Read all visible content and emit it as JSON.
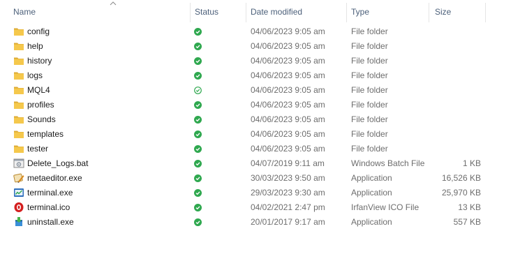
{
  "columns": {
    "name": "Name",
    "status": "Status",
    "date_modified": "Date modified",
    "type": "Type",
    "size": "Size"
  },
  "colors": {
    "folder": "#f5c84c",
    "status_green": "#2fa84f",
    "header_text": "#4c607a",
    "secondary_text": "#6d6d6d"
  },
  "files": [
    {
      "name": "config",
      "icon": "folder-icon",
      "status": "synced-filled",
      "date": "04/06/2023 9:05 am",
      "type": "File folder",
      "size": ""
    },
    {
      "name": "help",
      "icon": "folder-icon",
      "status": "synced-filled",
      "date": "04/06/2023 9:05 am",
      "type": "File folder",
      "size": ""
    },
    {
      "name": "history",
      "icon": "folder-icon",
      "status": "synced-filled",
      "date": "04/06/2023 9:05 am",
      "type": "File folder",
      "size": ""
    },
    {
      "name": "logs",
      "icon": "folder-icon",
      "status": "synced-filled",
      "date": "04/06/2023 9:05 am",
      "type": "File folder",
      "size": ""
    },
    {
      "name": "MQL4",
      "icon": "folder-icon",
      "status": "synced-outline",
      "date": "04/06/2023 9:05 am",
      "type": "File folder",
      "size": ""
    },
    {
      "name": "profiles",
      "icon": "folder-icon",
      "status": "synced-filled",
      "date": "04/06/2023 9:05 am",
      "type": "File folder",
      "size": ""
    },
    {
      "name": "Sounds",
      "icon": "folder-icon",
      "status": "synced-filled",
      "date": "04/06/2023 9:05 am",
      "type": "File folder",
      "size": ""
    },
    {
      "name": "templates",
      "icon": "folder-icon",
      "status": "synced-filled",
      "date": "04/06/2023 9:05 am",
      "type": "File folder",
      "size": ""
    },
    {
      "name": "tester",
      "icon": "folder-icon",
      "status": "synced-filled",
      "date": "04/06/2023 9:05 am",
      "type": "File folder",
      "size": ""
    },
    {
      "name": "Delete_Logs.bat",
      "icon": "batch-file-icon",
      "status": "synced-filled",
      "date": "04/07/2019 9:11 am",
      "type": "Windows Batch File",
      "size": "1 KB"
    },
    {
      "name": "metaeditor.exe",
      "icon": "metaeditor-icon",
      "status": "synced-filled",
      "date": "30/03/2023 9:50 am",
      "type": "Application",
      "size": "16,526 KB"
    },
    {
      "name": "terminal.exe",
      "icon": "terminal-exe-icon",
      "status": "synced-filled",
      "date": "29/03/2023 9:30 am",
      "type": "Application",
      "size": "25,970 KB"
    },
    {
      "name": "terminal.ico",
      "icon": "ico-file-icon",
      "status": "synced-filled",
      "date": "04/02/2021 2:47 pm",
      "type": "IrfanView ICO File",
      "size": "13 KB"
    },
    {
      "name": "uninstall.exe",
      "icon": "uninstall-icon",
      "status": "synced-filled",
      "date": "20/01/2017 9:17 am",
      "type": "Application",
      "size": "557 KB"
    }
  ]
}
